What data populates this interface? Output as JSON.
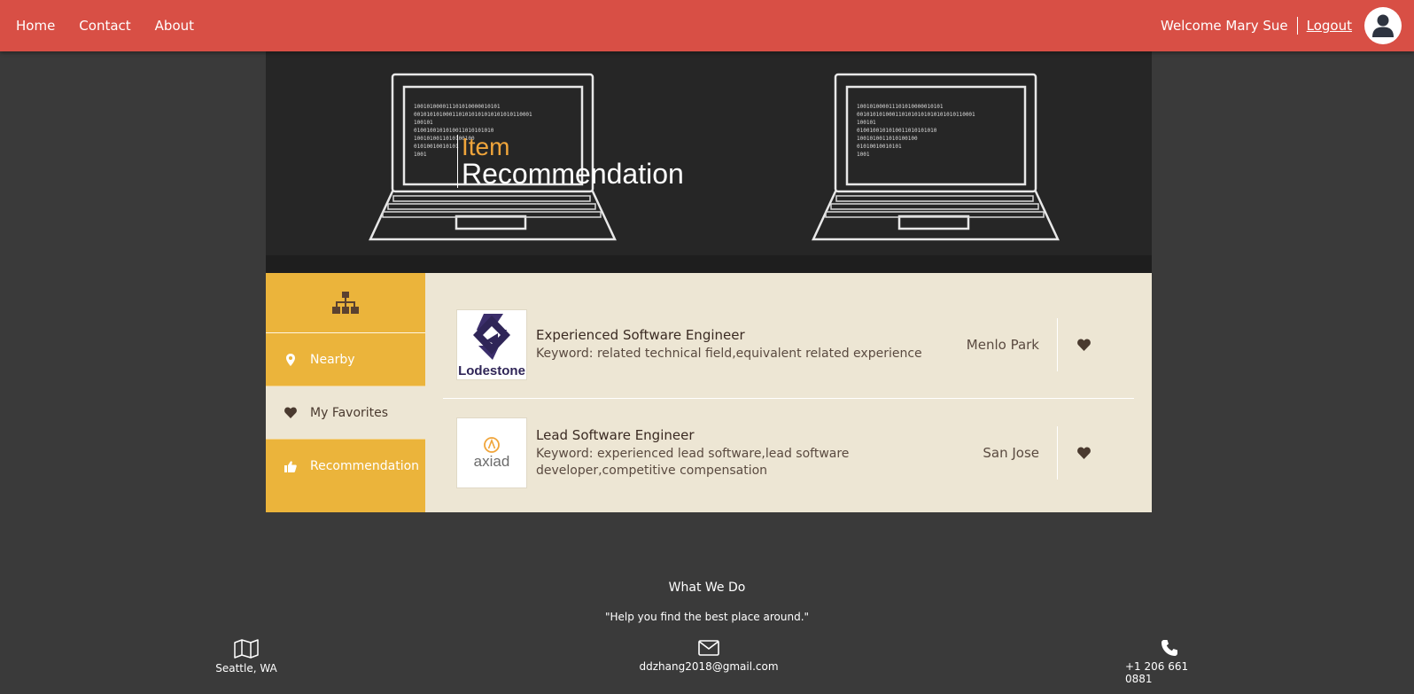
{
  "nav": {
    "links": [
      "Home",
      "Contact",
      "About"
    ],
    "welcome": "Welcome Mary Sue",
    "logout": "Logout"
  },
  "hero": {
    "line1": "Item",
    "line2": "Recommendation"
  },
  "sidebar": {
    "items": [
      {
        "label": "Nearby",
        "icon": "map-marker-icon"
      },
      {
        "label": "My Favorites",
        "icon": "heart-icon"
      },
      {
        "label": "Recommendation",
        "icon": "thumbs-up-icon"
      }
    ],
    "active": "My Favorites"
  },
  "items": [
    {
      "title": "Experienced Software Engineer",
      "keyword": "Keyword: related technical field,equivalent related experience",
      "location": "Menlo Park",
      "logo_text": "Lodestone"
    },
    {
      "title": "Lead Software Engineer",
      "keyword": "Keyword: experienced lead software,lead software developer,competitive compensation",
      "location": "San Jose",
      "logo_text": "axiad"
    }
  ],
  "footer": {
    "title": "What We Do",
    "quote": "\"Help you find the best place around.\"",
    "location": "Seattle, WA",
    "email": "ddzhang2018@gmail.com",
    "phone": "+1 206 661 0881"
  },
  "colors": {
    "topbar": "#d84f45",
    "sidebar": "#ebb43b",
    "content_bg": "#ede6d4",
    "accent": "#f0a53b",
    "heart": "#4a3a2f"
  }
}
